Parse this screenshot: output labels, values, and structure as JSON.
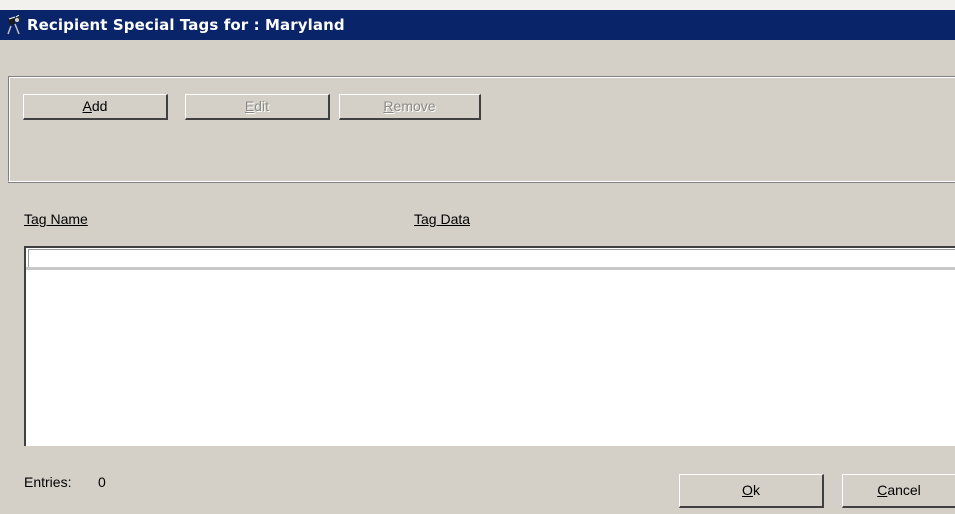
{
  "window": {
    "title": "Recipient Special Tags for : Maryland",
    "icon": "satellite-dish-icon"
  },
  "toolbar": {
    "add_label": "Add",
    "add_mnemonic": "A",
    "add_rest": "dd",
    "edit_label": "Edit",
    "edit_mnemonic": "E",
    "edit_rest": "dit",
    "remove_label": "Remove",
    "remove_mnemonic": "R",
    "remove_rest": "emove"
  },
  "table": {
    "columns": [
      {
        "label": "Tag Name"
      },
      {
        "label": "Tag Data"
      }
    ],
    "rows": []
  },
  "footer": {
    "entries_label": "Entries:",
    "entries_count": "0",
    "ok_label": "Ok",
    "ok_mnemonic": "O",
    "ok_rest": "k",
    "cancel_label": "Cancel",
    "cancel_mnemonic": "C",
    "cancel_rest": "ancel"
  },
  "colors": {
    "titlebar": "#0a246a",
    "face": "#d4d0c8",
    "disabled_text": "#8c8a84"
  }
}
